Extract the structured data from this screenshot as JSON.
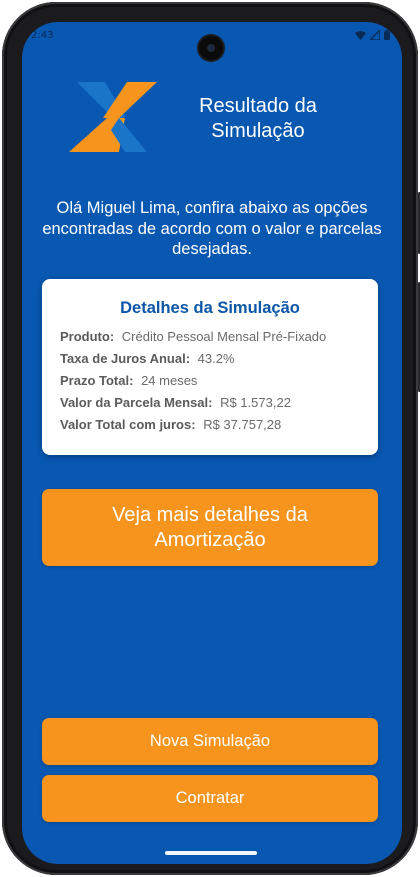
{
  "status_bar": {
    "time": "2:43",
    "icons": [
      "wifi-icon",
      "signal-icon",
      "battery-icon"
    ]
  },
  "logo": {
    "name": "caixa-x-logo",
    "colors": {
      "blue": "#1a75c9",
      "orange": "#f7941d"
    }
  },
  "header": {
    "title": "Resultado da Simulação"
  },
  "greeting": "Olá Miguel Lima, confira abaixo as opções encontradas de acordo com o valor e parcelas desejadas.",
  "details": {
    "title": "Detalhes da Simulação",
    "rows": [
      {
        "label": "Produto:",
        "value": "Crédito Pessoal Mensal Pré-Fixado"
      },
      {
        "label": "Taxa de Juros Anual:",
        "value": "43.2%"
      },
      {
        "label": "Prazo Total:",
        "value": "24 meses"
      },
      {
        "label": "Valor da Parcela Mensal:",
        "value": "R$ 1.573,22"
      },
      {
        "label": "Valor Total com juros:",
        "value": "R$ 37.757,28"
      }
    ]
  },
  "buttons": {
    "amortization": "Veja mais detalhes da Amortização",
    "new_simulation": "Nova Simulação",
    "contract": "Contratar"
  },
  "colors": {
    "background": "#0857b0",
    "accent": "#f7941d",
    "card_title": "#0b56a8",
    "card_bg": "#ffffff"
  }
}
